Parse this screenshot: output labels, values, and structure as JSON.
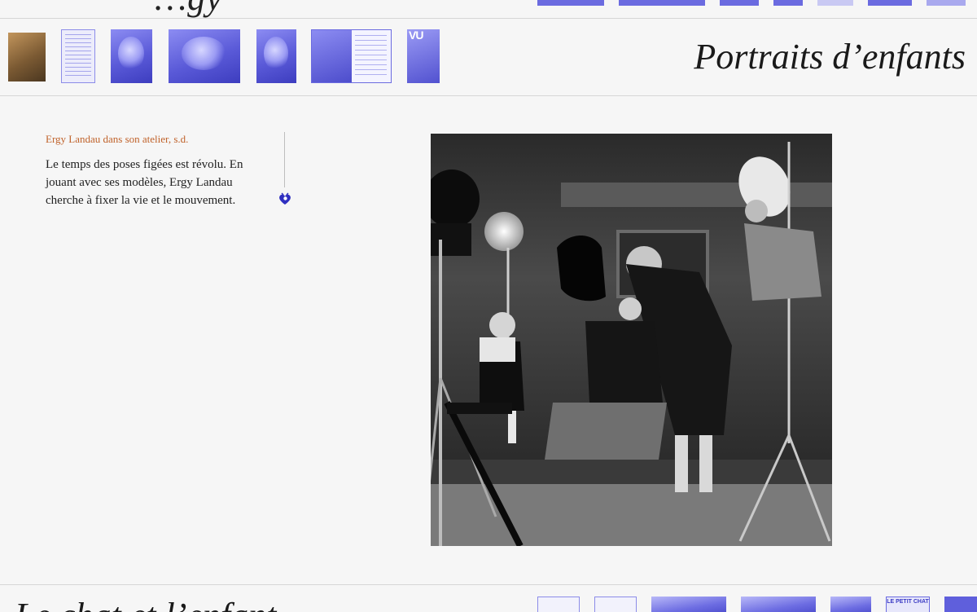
{
  "previous_section": {
    "title": "…gy"
  },
  "chapter": {
    "title": "Portraits d’enfants",
    "thumbnails": [
      {
        "name": "thumb-atelier",
        "kind": "sepia"
      },
      {
        "name": "thumb-document",
        "kind": "doc"
      },
      {
        "name": "thumb-child-eating",
        "kind": "photo"
      },
      {
        "name": "thumb-child-candles",
        "kind": "photo"
      },
      {
        "name": "thumb-child-laughing",
        "kind": "photo"
      },
      {
        "name": "thumb-magazine-spread",
        "kind": "spread"
      },
      {
        "name": "thumb-vu-cover",
        "kind": "vu",
        "text": "VU"
      }
    ]
  },
  "caption": {
    "credit": "Ergy Landau dans son atelier, s.d.",
    "description": "Le temps des poses figées est révolu. En jouant avec ses modèles, Ergy Landau cherche à fixer la vie et le mouvement."
  },
  "favorite_icon": "heart-icon",
  "next_section": {
    "title": "Le chat et l’enfant",
    "chat_thumb_text": "LE PETIT CHAT"
  },
  "colors": {
    "accent": "#6b6be0",
    "credit": "#c0622a",
    "text": "#222222",
    "background": "#f6f6f6"
  }
}
